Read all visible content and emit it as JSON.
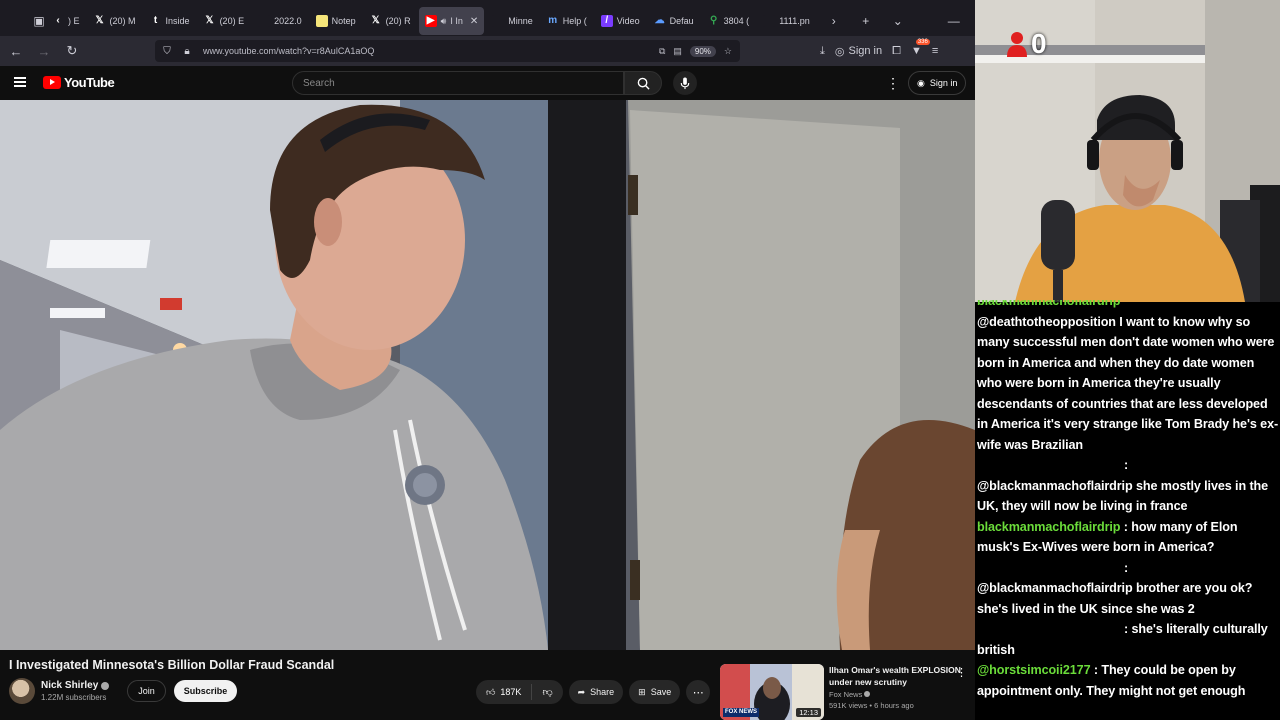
{
  "browser": {
    "tabs": [
      {
        "label": ") E",
        "icon": "chevron-left-icon",
        "active": false
      },
      {
        "label": "(20) M",
        "icon": "x-logo-icon",
        "active": false
      },
      {
        "label": "Inside",
        "icon": "t-logo-icon",
        "active": false
      },
      {
        "label": "(20) E",
        "icon": "x-logo-icon",
        "active": false
      },
      {
        "label": "2022.0",
        "icon": "blank-page-icon",
        "active": false
      },
      {
        "label": "Notep",
        "icon": "notepad-icon",
        "active": false
      },
      {
        "label": "(20) R",
        "icon": "x-logo-icon",
        "active": false
      },
      {
        "label": "I In",
        "icon": "youtube-icon",
        "active": true
      },
      {
        "label": "Minne",
        "icon": "blank-page-icon",
        "active": false
      },
      {
        "label": "Help (",
        "icon": "mi-icon",
        "active": false
      },
      {
        "label": "Video",
        "icon": "video-editor-icon",
        "active": false
      },
      {
        "label": "Defau",
        "icon": "cloud-icon",
        "active": false
      },
      {
        "label": "3804 (",
        "icon": "map-pin-icon",
        "active": false
      },
      {
        "label": "1111.pn",
        "icon": "blank-page-icon",
        "active": false
      }
    ],
    "url": "www.youtube.com/watch?v=r8AulCA1aOQ",
    "zoom": "90%",
    "sign_in": "Sign in",
    "extension_badge": "336"
  },
  "youtube": {
    "logo_text": "YouTube",
    "search_placeholder": "Search",
    "sign_in": "Sign in",
    "video_title": "I Investigated Minnesota's Billion Dollar Fraud Scandal",
    "channel_name": "Nick Shirley",
    "subscribers": "1.22M subscribers",
    "join_label": "Join",
    "subscribe_label": "Subscribe",
    "likes": "187K",
    "share_label": "Share",
    "save_label": "Save",
    "recommended": {
      "title": "Ilhan Omar's wealth EXPLOSION under new scrutiny",
      "channel": "Fox News",
      "meta": "591K views • 6 hours ago",
      "duration": "12:13",
      "thumb_badge": "FOX NEWS"
    }
  },
  "overlay": {
    "viewer_count": "0",
    "chat": [
      {
        "user": "blackmanmachoflairdrip",
        "text": "",
        "partial": true
      },
      {
        "user": "",
        "text": "@deathtotheopposition I want to know why so many successful men don't date women who were born in America and when they do date women who were born in America they're usually descendants of countries that are less developed in America it's very strange like Tom Brady he's ex-wife was Brazilian"
      },
      {
        "user": "",
        "text": ":",
        "colon_only": true
      },
      {
        "user": "",
        "text": "@blackmanmachoflairdrip she mostly lives in the UK, they will now be living in france"
      },
      {
        "user": "blackmanmachoflairdrip",
        "text": " : how many of Elon musk's Ex-Wives were born in America?"
      },
      {
        "user": "",
        "text": ":",
        "colon_only": true
      },
      {
        "user": "",
        "text": "@blackmanmachoflairdrip brother are you ok? she's lived in the UK since she was 2"
      },
      {
        "user": "",
        "text": ": she's literally culturally british",
        "hanging": true
      },
      {
        "user": "@horstsimcoii2177",
        "text": " : They could be open by appointment only. They might not get enough"
      }
    ]
  },
  "colors": {
    "youtube_red": "#ff0000",
    "chat_username": "#6bdc3a",
    "browser_tabbar": "#1c1b22"
  }
}
